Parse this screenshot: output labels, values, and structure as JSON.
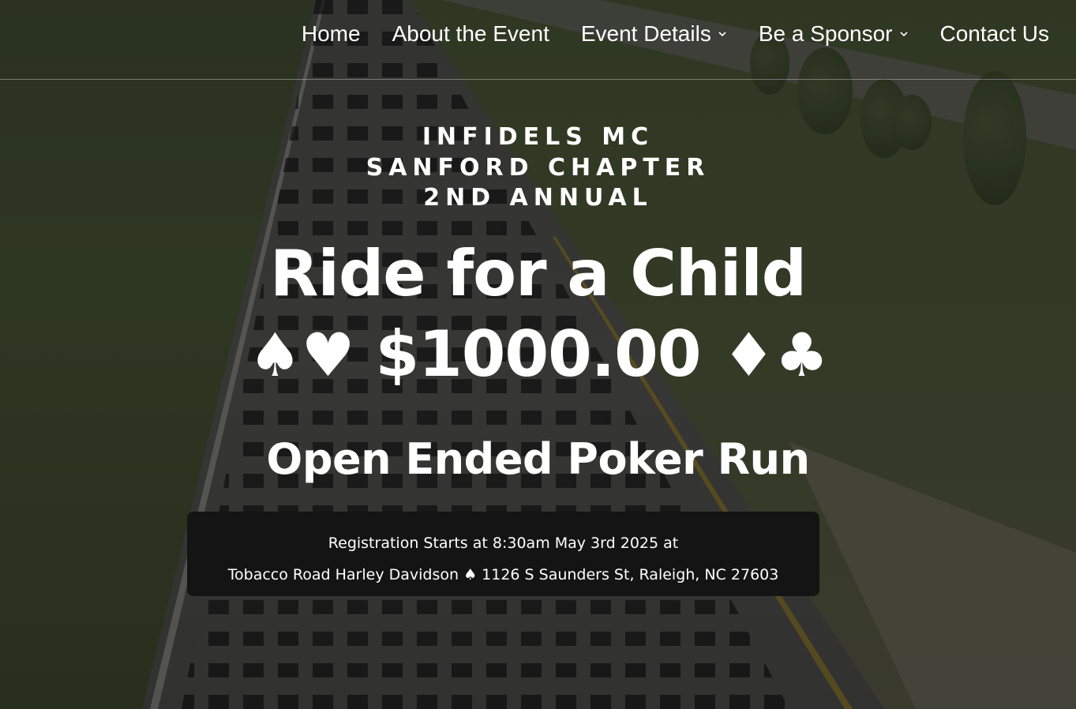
{
  "nav": {
    "items": [
      {
        "label": "Home",
        "has_dropdown": false
      },
      {
        "label": "About the Event",
        "has_dropdown": false
      },
      {
        "label": "Event Details",
        "has_dropdown": true
      },
      {
        "label": "Be a Sponsor",
        "has_dropdown": true
      },
      {
        "label": "Contact Us",
        "has_dropdown": false
      }
    ]
  },
  "hero": {
    "kicker_line1": "INFIDELS MC",
    "kicker_line2": "SANFORD CHAPTER",
    "kicker_line3": "2ND ANNUAL",
    "title": "Ride for a Child",
    "prize_left_suits": "♠♥",
    "prize_amount": "$1000.00",
    "prize_right_suits": "♦♣",
    "subtitle": "Open Ended Poker Run",
    "info_line1": "Registration Starts at 8:30am May 3rd 2025 at",
    "info_line2": "Tobacco Road Harley Davidson ♠ 1126 S Saunders St, Raleigh, NC 27603"
  },
  "colors": {
    "text": "#ffffff",
    "info_box_bg": "#141414",
    "overlay": "rgba(0,0,0,0.45)"
  },
  "icons": {
    "dropdown": "chevron-down-icon"
  }
}
